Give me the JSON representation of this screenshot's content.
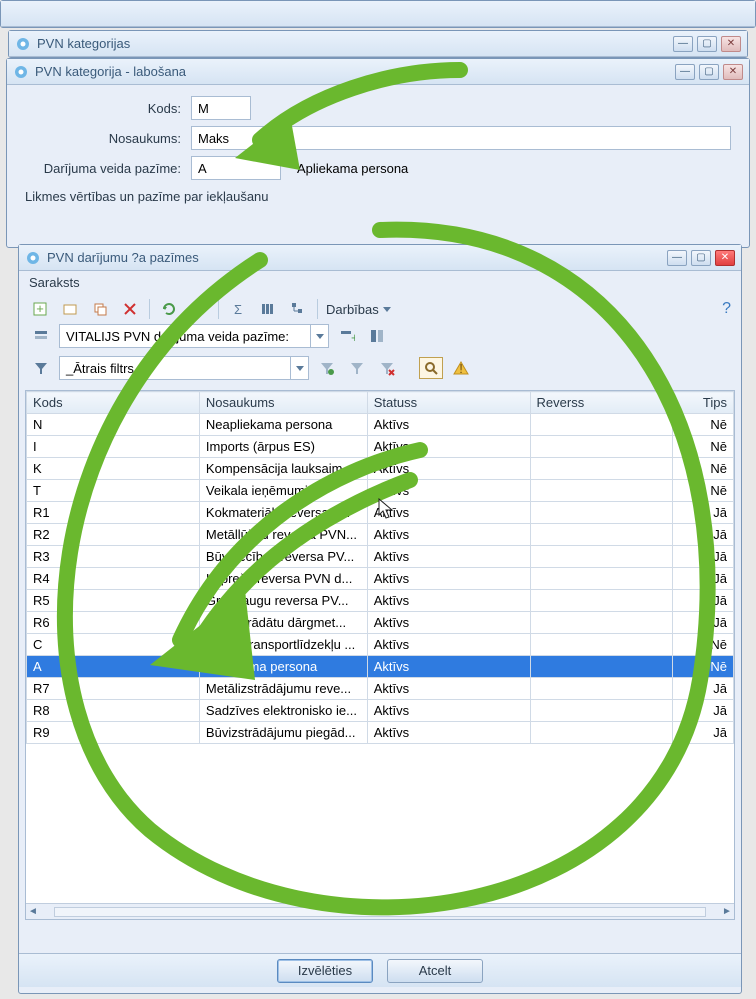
{
  "bg_window0_title": "",
  "window_list_parent": {
    "title": "PVN kategorijas"
  },
  "window_edit": {
    "title": "PVN kategorija - labošana",
    "labels": {
      "code": "Kods:",
      "name": "Nosaukums:",
      "mark": "Darījuma veida pazīme:"
    },
    "values": {
      "code": "M",
      "name": "Maks",
      "mark_code": "A",
      "mark_name": "Apliekama persona"
    },
    "note": "Likmes vērtības un pazīme par iekļaušanu"
  },
  "window_marks": {
    "title": "PVN darījumu ?a pazīmes",
    "menu": "Saraksts",
    "actions_label": "Darbības",
    "view_combo": "VITALIJS PVN darījuma veida pazīme:",
    "filter_combo": "_Ātrais filtrs_",
    "columns": {
      "code": "Kods",
      "name": "Nosaukums",
      "status": "Statuss",
      "reverse": "Reverss",
      "tips": "Tips"
    },
    "rows": [
      {
        "code": "N",
        "name": "Neapliekama persona",
        "status": "Aktīvs",
        "reverse": "",
        "tips": "Nē"
      },
      {
        "code": "I",
        "name": "Imports (ārpus ES)",
        "status": "Aktīvs",
        "reverse": "",
        "tips": "Nē"
      },
      {
        "code": "K",
        "name": "Kompensācija lauksaim...",
        "status": "Aktīvs",
        "reverse": "",
        "tips": "Nē"
      },
      {
        "code": "T",
        "name": "Veikala ieņēmumi",
        "status": "Aktīvs",
        "reverse": "",
        "tips": "Nē"
      },
      {
        "code": "R1",
        "name": "Kokmateriālu reversa P...",
        "status": "Aktīvs",
        "reverse": "",
        "tips": "Jā"
      },
      {
        "code": "R2",
        "name": "Metāllūžņu reversa PVN...",
        "status": "Aktīvs",
        "reverse": "",
        "tips": "Jā"
      },
      {
        "code": "R3",
        "name": "Būvniecības reversa PV...",
        "status": "Aktīvs",
        "reverse": "",
        "tips": "Jā"
      },
      {
        "code": "R4",
        "name": "IT preču reversa PVN d...",
        "status": "Aktīvs",
        "reverse": "",
        "tips": "Jā"
      },
      {
        "code": "R5",
        "name": "Graudaugu reversa PV...",
        "status": "Aktīvs",
        "reverse": "",
        "tips": "Jā"
      },
      {
        "code": "R6",
        "name": "Neapstrādātu dārgmet...",
        "status": "Aktīvs",
        "reverse": "",
        "tips": "Jā"
      },
      {
        "code": "C",
        "name": "Vieglo transportlīdzekļu ...",
        "status": "Aktīvs",
        "reverse": "",
        "tips": "Nē"
      },
      {
        "code": "A",
        "name": "Apliekama persona",
        "status": "Aktīvs",
        "reverse": "",
        "tips": "Nē",
        "selected": true
      },
      {
        "code": "R7",
        "name": "Metālizstrādājumu reve...",
        "status": "Aktīvs",
        "reverse": "",
        "tips": "Jā"
      },
      {
        "code": "R8",
        "name": "Sadzīves elektronisko ie...",
        "status": "Aktīvs",
        "reverse": "",
        "tips": "Jā"
      },
      {
        "code": "R9",
        "name": "Būvizstrādājumu piegād...",
        "status": "Aktīvs",
        "reverse": "",
        "tips": "Jā"
      }
    ],
    "buttons": {
      "select": "Izvēlēties",
      "cancel": "Atcelt"
    }
  }
}
